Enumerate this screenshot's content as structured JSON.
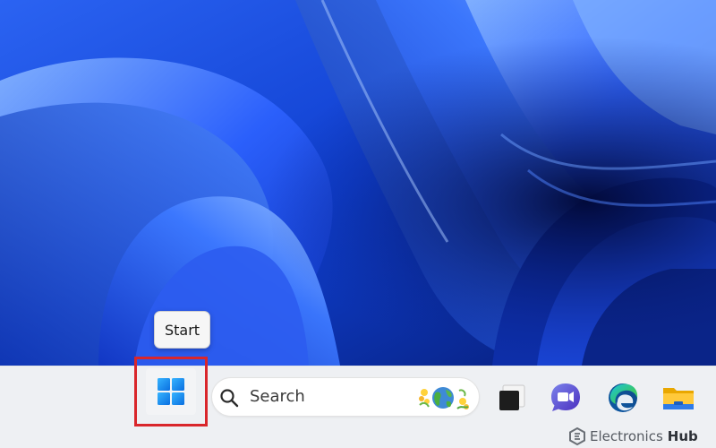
{
  "tooltip": {
    "text": "Start"
  },
  "taskbar": {
    "search": {
      "placeholder": "Search"
    },
    "icons": [
      "windows-start-icon",
      "search-icon",
      "search-highlight-icon",
      "task-view-icon",
      "teams-chat-icon",
      "edge-icon",
      "file-explorer-icon"
    ]
  },
  "watermark": {
    "brand": "Electronics",
    "brand_strong": "Hub"
  },
  "colors": {
    "wallpaper_dark": "#061a6e",
    "wallpaper_mid": "#1f4fe0",
    "wallpaper_light": "#6fa6ff",
    "highlight_border": "#d9262b",
    "taskbar": "#eef0f3"
  }
}
